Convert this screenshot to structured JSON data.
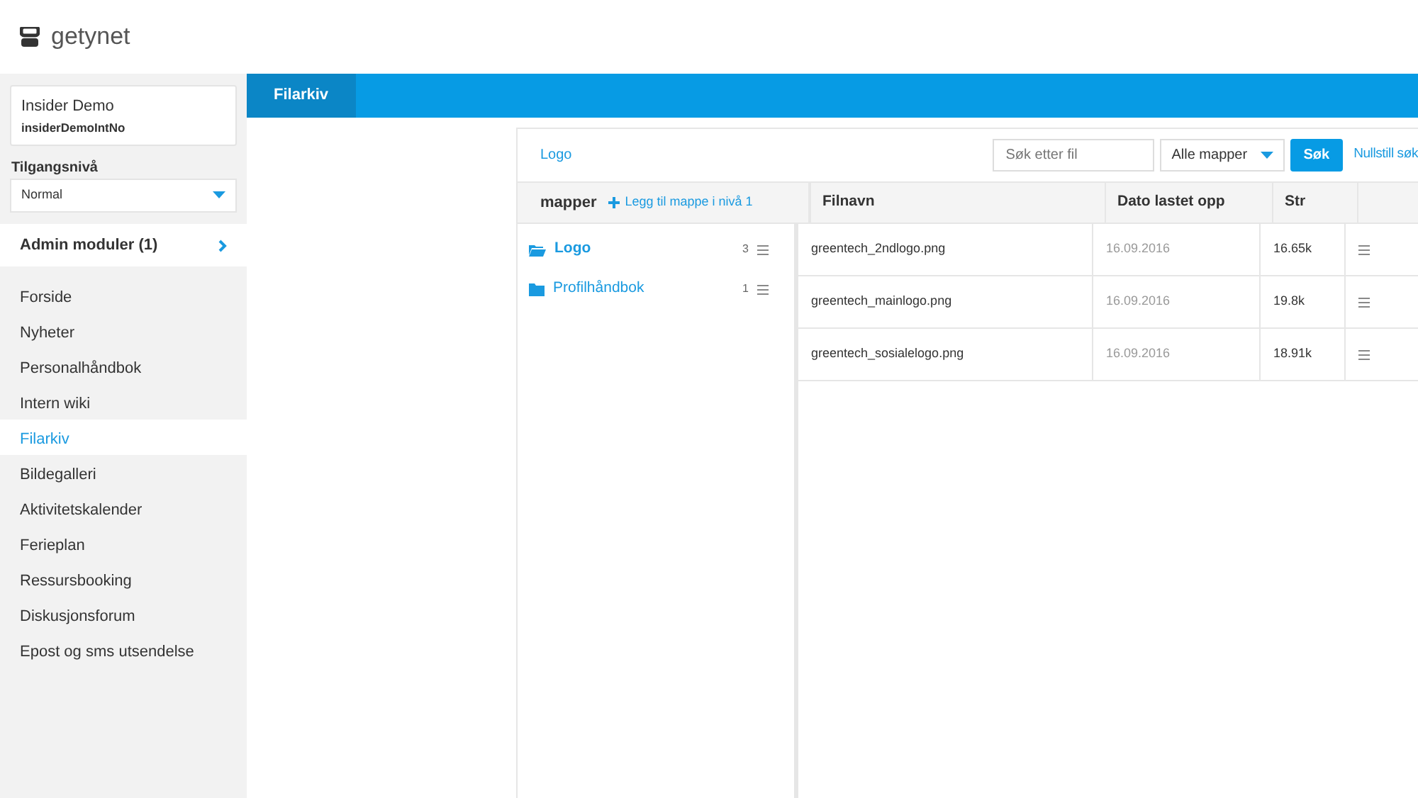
{
  "brand": {
    "name": "getynet"
  },
  "user": {
    "name": "Insider Demo",
    "username": "insiderDemoIntNo"
  },
  "access": {
    "label": "Tilgangsnivå",
    "value": "Normal"
  },
  "admin": {
    "label": "Admin moduler (1)"
  },
  "sidebar": {
    "items": [
      {
        "label": "Forside",
        "selected": false
      },
      {
        "label": "Nyheter",
        "selected": false
      },
      {
        "label": "Personalhåndbok",
        "selected": false
      },
      {
        "label": "Intern wiki",
        "selected": false
      },
      {
        "label": "Filarkiv",
        "selected": true
      },
      {
        "label": "Bildegalleri",
        "selected": false
      },
      {
        "label": "Aktivitetskalender",
        "selected": false
      },
      {
        "label": "Ferieplan",
        "selected": false
      },
      {
        "label": "Ressursbooking",
        "selected": false
      },
      {
        "label": "Diskusjonsforum",
        "selected": false
      },
      {
        "label": "Epost og sms utsendelse",
        "selected": false
      }
    ]
  },
  "tabs": [
    {
      "label": "Filarkiv",
      "selected": true
    }
  ],
  "breadcrumb": "Logo",
  "search": {
    "placeholder": "Søk etter fil",
    "folder_filter": "Alle mapper",
    "button": "Søk",
    "reset": "Nullstill søk"
  },
  "folders": {
    "title": "mapper",
    "add": "Legg til mappe i nivå 1",
    "items": [
      {
        "name": "Logo",
        "count": "3",
        "selected": true
      },
      {
        "name": "Profilhåndbok",
        "count": "1",
        "selected": false
      }
    ]
  },
  "table": {
    "columns": [
      "Filnavn",
      "Dato lastet opp",
      "Str"
    ],
    "rows": [
      [
        "greentech_2ndlogo.png",
        "16.09.2016",
        "16.65k"
      ],
      [
        "greentech_mainlogo.png",
        "16.09.2016",
        "19.8k"
      ],
      [
        "greentech_sosialelogo.png",
        "16.09.2016",
        "18.91k"
      ]
    ]
  }
}
